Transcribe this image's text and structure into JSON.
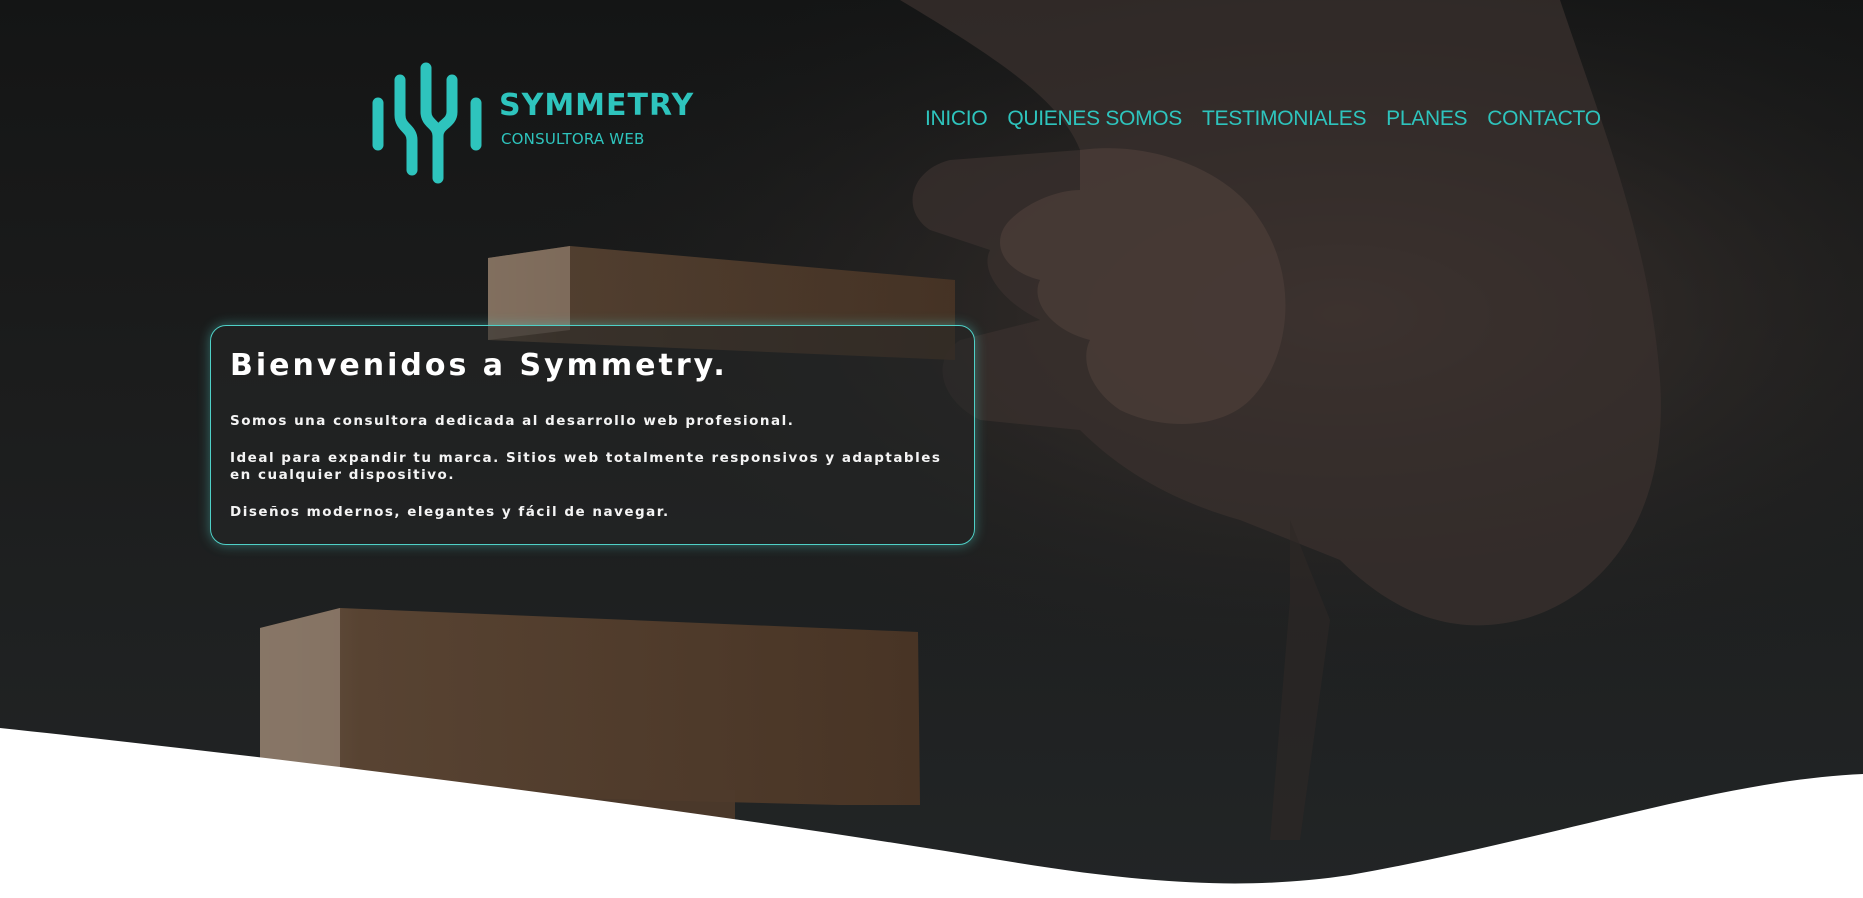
{
  "brand": {
    "name": "SYMMETRY",
    "tagline": "CONSULTORA WEB",
    "accent_color": "#2ec4bd"
  },
  "nav": {
    "items": [
      {
        "label": "INICIO"
      },
      {
        "label": "QUIENES SOMOS"
      },
      {
        "label": "TESTIMONIALES"
      },
      {
        "label": "PLANES"
      },
      {
        "label": "CONTACTO"
      }
    ]
  },
  "hero": {
    "title": "Bienvenidos a Symmetry.",
    "paragraphs": [
      "Somos una consultora dedicada al desarrollo web profesional.",
      "Ideal para expandir tu marca. Sitios web totalmente responsivos y adaptables en cualquier dispositivo.",
      "Diseños modernos, elegantes y fácil de navegar."
    ]
  }
}
